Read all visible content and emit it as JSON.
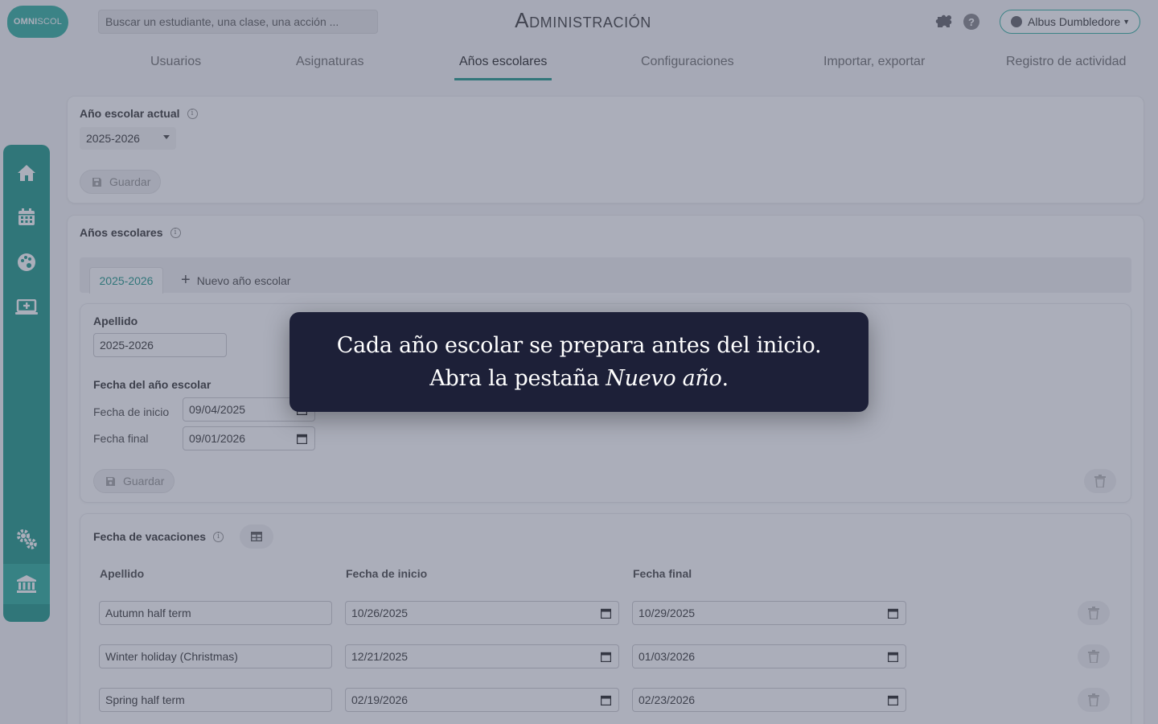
{
  "header": {
    "logo_text_bold": "OMNI",
    "logo_text_light": "SCOL",
    "search_placeholder": "Buscar un estudiante, una clase, una acción ...",
    "title": "Administración",
    "user_name": "Albus Dumbledore"
  },
  "tabs": [
    {
      "label": "Usuarios",
      "active": false
    },
    {
      "label": "Asignaturas",
      "active": false
    },
    {
      "label": "Años escolares",
      "active": true
    },
    {
      "label": "Configuraciones",
      "active": false
    },
    {
      "label": "Importar, exportar",
      "active": false
    },
    {
      "label": "Registro de actividad",
      "active": false
    }
  ],
  "sidebar": {
    "items": [
      "home-icon",
      "calendar-icon",
      "palette-icon",
      "laptop-add-icon",
      "settings-gears-icon",
      "school-building-icon"
    ],
    "active": "school-building-icon"
  },
  "current_year": {
    "title": "Año escolar actual",
    "selected": "2025-2026",
    "save_label": "Guardar"
  },
  "school_years": {
    "title": "Años escolares",
    "tab_active": "2025-2026",
    "tab_new": "Nuevo año escolar",
    "name_label": "Apellido",
    "name_value": "2025-2026",
    "dates_title": "Fecha del año escolar",
    "start_label": "Fecha de inicio",
    "start_value": "09/04/2025",
    "end_label": "Fecha final",
    "end_value": "09/01/2026",
    "save_label": "Guardar"
  },
  "holidays": {
    "title": "Fecha de vacaciones",
    "col_name": "Apellido",
    "col_start": "Fecha de inicio",
    "col_end": "Fecha final",
    "rows": [
      {
        "name": "Autumn half term",
        "start": "10/26/2025",
        "end": "10/29/2025"
      },
      {
        "name": "Winter holiday (Christmas)",
        "start": "12/21/2025",
        "end": "01/03/2026"
      },
      {
        "name": "Spring half term",
        "start": "02/19/2026",
        "end": "02/23/2026"
      }
    ]
  },
  "tooltip": {
    "text_before": "Cada año escolar se prepara antes del inicio. Abra la pestaña ",
    "text_emphasis": "Nuevo año",
    "text_after": "."
  },
  "colors": {
    "accent": "#2f9f91",
    "sidebar": "#2c9f8f",
    "overlay": "#373e5a",
    "tooltip_bg": "#1d2038"
  }
}
